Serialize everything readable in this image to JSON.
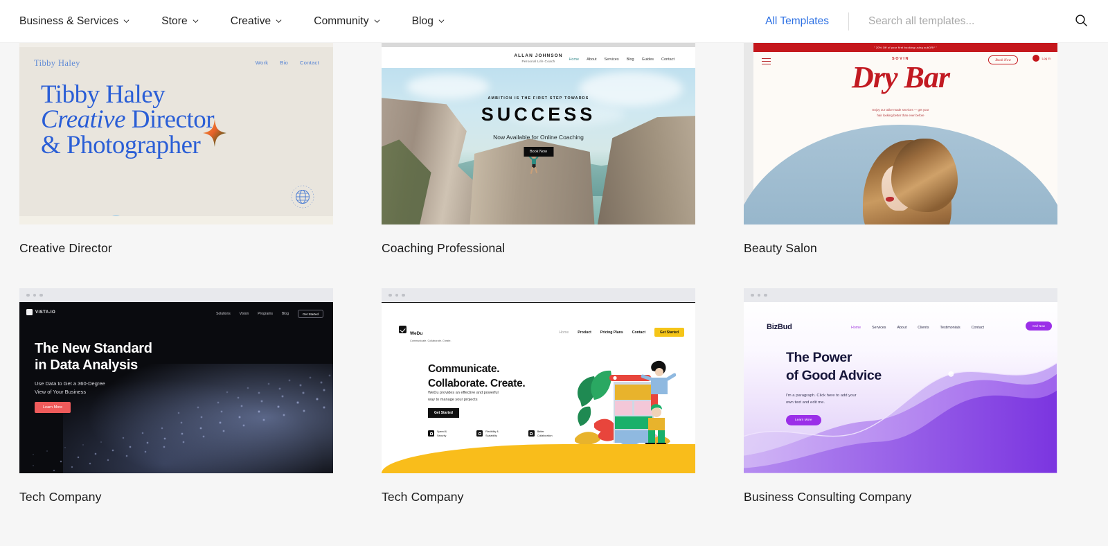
{
  "header": {
    "nav_items": [
      {
        "label": "Business & Services",
        "has_dropdown": true
      },
      {
        "label": "Store",
        "has_dropdown": true
      },
      {
        "label": "Creative",
        "has_dropdown": true
      },
      {
        "label": "Community",
        "has_dropdown": true
      },
      {
        "label": "Blog",
        "has_dropdown": true
      }
    ],
    "all_templates_label": "All Templates",
    "search": {
      "value": "",
      "placeholder": "Search all templates..."
    },
    "search_icon": "search-icon",
    "accent_link_color": "#2b6fe3"
  },
  "templates": [
    {
      "title": "Creative Director",
      "preview": {
        "logo": "Tibby Haley",
        "nav": [
          "Work",
          "Bio",
          "Contact"
        ],
        "heading_line1": "Tibby Haley",
        "heading_line2_italic": "Creative",
        "heading_line2_rest": " Director",
        "heading_line3": "& Photographer",
        "badge_text": "work around the globe",
        "bg_color": "#e9e5dd",
        "text_color": "#2a5ed6"
      }
    },
    {
      "title": "Coaching Professional",
      "preview": {
        "brand_name": "ALLAN JOHNSON",
        "brand_subtitle": "Personal Life Coach",
        "nav": [
          "Home",
          "About",
          "Services",
          "Blog",
          "Guides",
          "Contact"
        ],
        "kicker": "AMBITION IS THE FIRST STEP TOWARDS",
        "headline": "SUCCESS",
        "subhead": "Now Available for Online Coaching",
        "button_label": "Book Now"
      }
    },
    {
      "title": "Beauty Salon",
      "preview": {
        "promo_bar": "\" 20% Off of your first booking using subDRY \"",
        "brand_small": "SOVIN",
        "brand_script": "Dry Bar",
        "tagline_line1": "Enjoy our tailor-made services — get your",
        "tagline_line2": "hair looking better than ever before",
        "book_button": "Book Now",
        "login_label": "Log In",
        "accent_color": "#c4171c"
      }
    },
    {
      "title": "Tech Company",
      "preview": {
        "logo": "VISTA.IO",
        "nav": [
          "Solutions",
          "Vision",
          "Programs",
          "Blog"
        ],
        "cta_label": "Get Started",
        "heading_line1": "The New Standard",
        "heading_line2": "in Data Analysis",
        "sub_line1": "Use Data to Get a 360-Degree",
        "sub_line2": "View of Your Business",
        "button_label": "Learn More",
        "bg_color": "#0a0b0f",
        "accent_color": "#ef5b5b"
      }
    },
    {
      "title": "Tech Company",
      "preview": {
        "logo": "WeDu",
        "logo_tagline": "Communicate. Collaborate. Create.",
        "nav": [
          "Home",
          "Product",
          "Pricing Plans",
          "Contact"
        ],
        "cta_label": "Get Started",
        "heading_line1": "Communicate.",
        "heading_line2": "Collaborate. Create.",
        "sub_line1": "WeDu provides an effective and powerful",
        "sub_line2": "way to manage your projects",
        "button_label": "Get Started",
        "features": [
          {
            "line1": "Speed &",
            "line2": "Security"
          },
          {
            "line1": "Flexibility &",
            "line2": "Scalability"
          },
          {
            "line1": "Better",
            "line2": "Collaboration"
          }
        ],
        "accent_color": "#f9bd1b"
      }
    },
    {
      "title": "Business Consulting Company",
      "preview": {
        "logo": "BizBud",
        "nav": [
          "Home",
          "Services",
          "About",
          "Clients",
          "Testimonials",
          "Contact"
        ],
        "cta_label": "Call Now",
        "heading_line1": "The Power",
        "heading_line2": "of Good Advice",
        "sub_line1": "I'm a paragraph. Click here to add your",
        "sub_line2": "own text and edit me.",
        "button_label": "Learn More",
        "accent_color": "#9b2fe8"
      }
    }
  ]
}
